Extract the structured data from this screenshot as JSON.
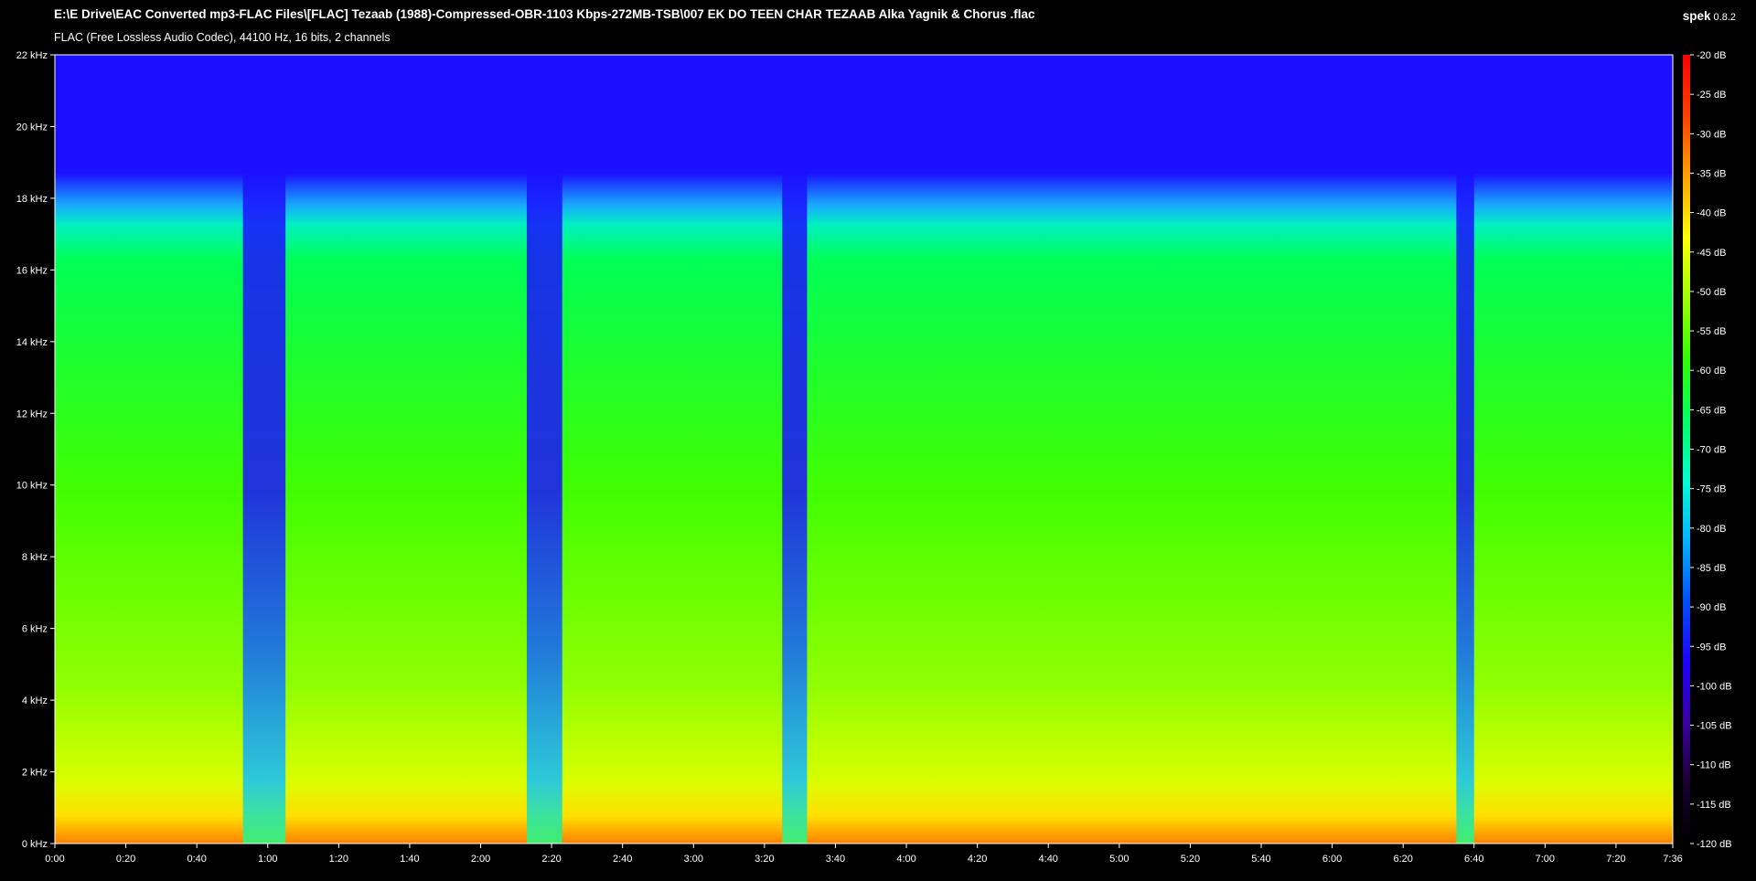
{
  "header": {
    "file_path": "E:\\E Drive\\EAC Converted mp3-FLAC Files\\[FLAC] Tezaab (1988)-Compressed-OBR-1103 Kbps-272MB-TSB\\007 EK DO TEEN CHAR TEZAAB Alka Yagnik & Chorus .flac",
    "codec_info": "FLAC (Free Lossless Audio Codec), 44100 Hz, 16 bits, 2 channels",
    "app_name": "spek",
    "app_version": "0.8.2"
  },
  "chart_data": {
    "type": "heatmap",
    "title": "",
    "x_axis": {
      "unit": "time",
      "range_seconds": [
        0,
        456
      ],
      "tick_seconds": [
        0,
        20,
        40,
        60,
        80,
        100,
        120,
        140,
        160,
        180,
        200,
        220,
        240,
        260,
        280,
        300,
        320,
        340,
        360,
        380,
        400,
        420,
        440,
        456
      ],
      "tick_labels": [
        "0:00",
        "0:20",
        "0:40",
        "1:00",
        "1:20",
        "1:40",
        "2:00",
        "2:20",
        "2:40",
        "3:00",
        "3:20",
        "3:40",
        "4:00",
        "4:20",
        "4:40",
        "5:00",
        "5:20",
        "5:40",
        "6:00",
        "6:20",
        "6:40",
        "7:00",
        "7:20",
        "7:36"
      ]
    },
    "y_axis": {
      "unit": "kHz",
      "range": [
        0,
        22
      ],
      "tick_values": [
        0,
        2,
        4,
        6,
        8,
        10,
        12,
        14,
        16,
        18,
        20,
        22
      ],
      "tick_labels": [
        "0 kHz",
        "2 kHz",
        "4 kHz",
        "6 kHz",
        "8 kHz",
        "10 kHz",
        "12 kHz",
        "14 kHz",
        "16 kHz",
        "18 kHz",
        "20 kHz",
        "22 kHz"
      ]
    },
    "color_scale": {
      "unit": "dB",
      "range": [
        -120,
        -20
      ],
      "tick_values": [
        -20,
        -25,
        -30,
        -35,
        -40,
        -45,
        -50,
        -55,
        -60,
        -65,
        -70,
        -75,
        -80,
        -85,
        -90,
        -95,
        -100,
        -105,
        -110,
        -115,
        -120
      ],
      "tick_labels": [
        "-20 dB",
        "-25 dB",
        "-30 dB",
        "-35 dB",
        "-40 dB",
        "-45 dB",
        "-50 dB",
        "-55 dB",
        "-60 dB",
        "-65 dB",
        "-70 dB",
        "-75 dB",
        "-80 dB",
        "-85 dB",
        "-90 dB",
        "-95 dB",
        "-100 dB",
        "-105 dB",
        "-110 dB",
        "-115 dB",
        "-120 dB"
      ],
      "colors": [
        "#000000",
        "#1a0030",
        "#3a00a0",
        "#1f00ff",
        "#0050ff",
        "#00b4ff",
        "#00ffd0",
        "#00ff60",
        "#30ff00",
        "#a0ff00",
        "#ffff00",
        "#ffa000",
        "#ff4000",
        "#ff0000"
      ]
    },
    "spectral_cutoff_khz": 16,
    "low_level_time_ranges_seconds": [
      [
        53,
        65
      ],
      [
        133,
        143
      ],
      [
        205,
        212
      ],
      [
        395,
        400
      ]
    ],
    "background_color": "#000000"
  }
}
